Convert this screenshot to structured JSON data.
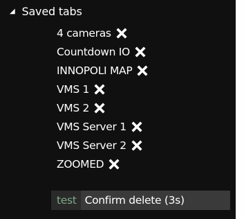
{
  "group": {
    "label": "Saved tabs",
    "expanded_icon": "triangle-down-icon"
  },
  "tabs": [
    {
      "label": "4 cameras"
    },
    {
      "label": "Countdown IO"
    },
    {
      "label": "INNOPOLI MAP"
    },
    {
      "label": "VMS 1"
    },
    {
      "label": "VMS 2"
    },
    {
      "label": "VMS Server 1"
    },
    {
      "label": "VMS Server 2"
    },
    {
      "label": "ZOOMED"
    }
  ],
  "pending_delete": {
    "tab_label": "test",
    "confirm_label": "Confirm delete (3s)"
  },
  "colors": {
    "panel_bg": "#101010",
    "text": "#ffffff",
    "pending_tab_text": "#7fa88a",
    "confirm_bg": "#3a3a3a"
  }
}
